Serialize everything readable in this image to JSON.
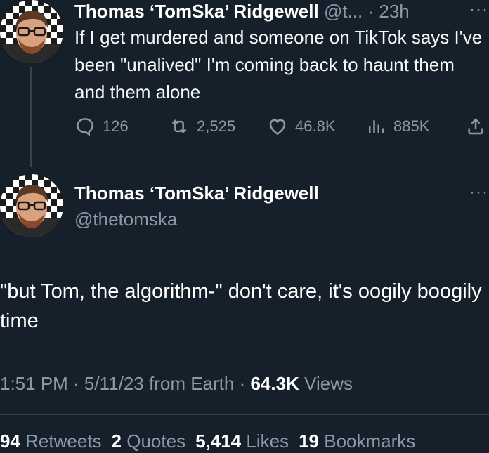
{
  "reply_tweet": {
    "author_name": "Thomas ‘TomSka’ Ridgewell",
    "handle_truncated": "@t...",
    "separator": "·",
    "time": "23h",
    "text": "If I get murdered and someone on TikTok says I've been \"unalived\" I'm coming back to haunt them and them alone",
    "replies": "126",
    "retweets": "2,525",
    "likes": "46.8K",
    "views": "885K",
    "icons": [
      "reply-icon",
      "retweet-icon",
      "like-icon",
      "views-icon",
      "share-icon"
    ]
  },
  "main_tweet": {
    "author_name": "Thomas ‘TomSka’ Ridgewell",
    "handle": "@thetomska",
    "text": "\"but Tom, the algorithm-\" don't care, it's oogily boogily time",
    "timestamp": "1:51 PM · 5/11/23 from Earth ·",
    "views_count": "64.3K",
    "views_label": "Views",
    "stats": {
      "retweets_count": "94",
      "retweets_label": "Retweets",
      "quotes_count": "2",
      "quotes_label": "Quotes",
      "likes_count": "5,414",
      "likes_label": "Likes",
      "bookmarks_count": "19",
      "bookmarks_label": "Bookmarks"
    }
  },
  "colors": {
    "background": "#15202b",
    "secondary_text": "#8b98a5",
    "primary_text": "#ffffff",
    "divider": "#38444d"
  }
}
